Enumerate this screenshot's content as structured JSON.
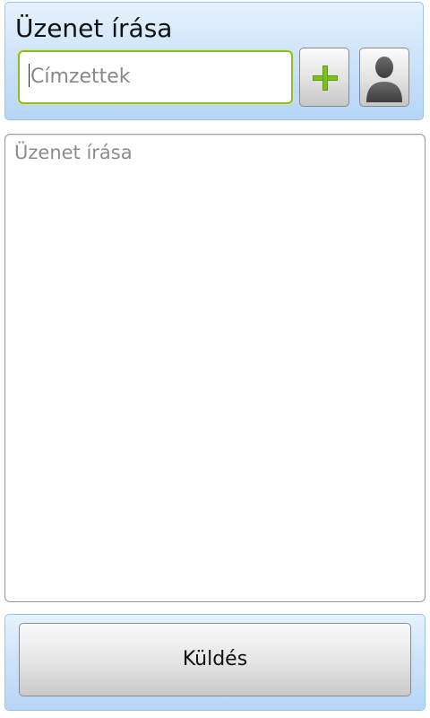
{
  "header": {
    "title": "Üzenet írása",
    "recipients": {
      "value": "",
      "placeholder": "Címzettek"
    },
    "add_button_icon": "plus-icon",
    "contact_button_icon": "person-icon"
  },
  "message": {
    "value": "",
    "placeholder": "Üzenet írása"
  },
  "footer": {
    "send_label": "Küldés"
  },
  "colors": {
    "panel_blue": "#cfe4fa",
    "focus_green": "#8dbd24",
    "plus_green": "#7cc21d",
    "person_gray": "#555555"
  }
}
